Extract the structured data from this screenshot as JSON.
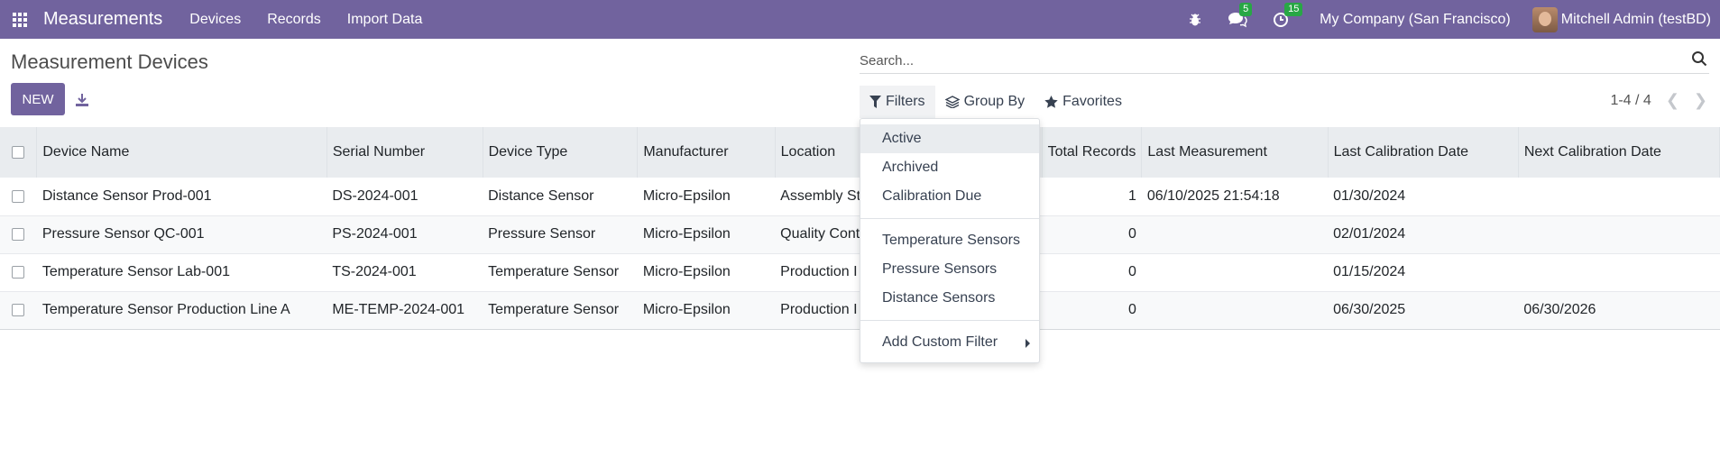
{
  "navbar": {
    "brand": "Measurements",
    "menu": [
      "Devices",
      "Records",
      "Import Data"
    ],
    "chat_count": "5",
    "activity_count": "15",
    "company": "My Company (San Francisco)",
    "user": "Mitchell Admin (testBD)",
    "bar_color": "#71639e"
  },
  "page": {
    "title": "Measurement Devices",
    "new_label": "NEW"
  },
  "search": {
    "placeholder": "Search..."
  },
  "filter_bar": {
    "filters": "Filters",
    "group_by": "Group By",
    "favorites": "Favorites"
  },
  "pager": {
    "range": "1-4 / 4"
  },
  "table": {
    "columns": [
      "Device Name",
      "Serial Number",
      "Device Type",
      "Manufacturer",
      "Location",
      "Total Records",
      "Last Measurement",
      "Last Calibration Date",
      "Next Calibration Date"
    ],
    "rows": [
      {
        "name": "Distance Sensor Prod-001",
        "serial": "DS-2024-001",
        "type": "Distance Sensor",
        "manufacturer": "Micro-Epsilon",
        "location": "Assembly St",
        "total": "1",
        "last_measurement": "06/10/2025 21:54:18",
        "last_cal": "01/30/2024",
        "next_cal": ""
      },
      {
        "name": "Pressure Sensor QC-001",
        "serial": "PS-2024-001",
        "type": "Pressure Sensor",
        "manufacturer": "Micro-Epsilon",
        "location": "Quality Cont",
        "total": "0",
        "last_measurement": "",
        "last_cal": "02/01/2024",
        "next_cal": ""
      },
      {
        "name": "Temperature Sensor Lab-001",
        "serial": "TS-2024-001",
        "type": "Temperature Sensor",
        "manufacturer": "Micro-Epsilon",
        "location": "Production I",
        "total": "0",
        "last_measurement": "",
        "last_cal": "01/15/2024",
        "next_cal": ""
      },
      {
        "name": "Temperature Sensor Production Line A",
        "serial": "ME-TEMP-2024-001",
        "type": "Temperature Sensor",
        "manufacturer": "Micro-Epsilon",
        "location": "Production I",
        "total": "0",
        "last_measurement": "",
        "last_cal": "06/30/2025",
        "next_cal": "06/30/2026"
      }
    ]
  },
  "filters_dropdown": {
    "group1": [
      "Active",
      "Archived",
      "Calibration Due"
    ],
    "group2": [
      "Temperature Sensors",
      "Pressure Sensors",
      "Distance Sensors"
    ],
    "custom": "Add Custom Filter"
  }
}
